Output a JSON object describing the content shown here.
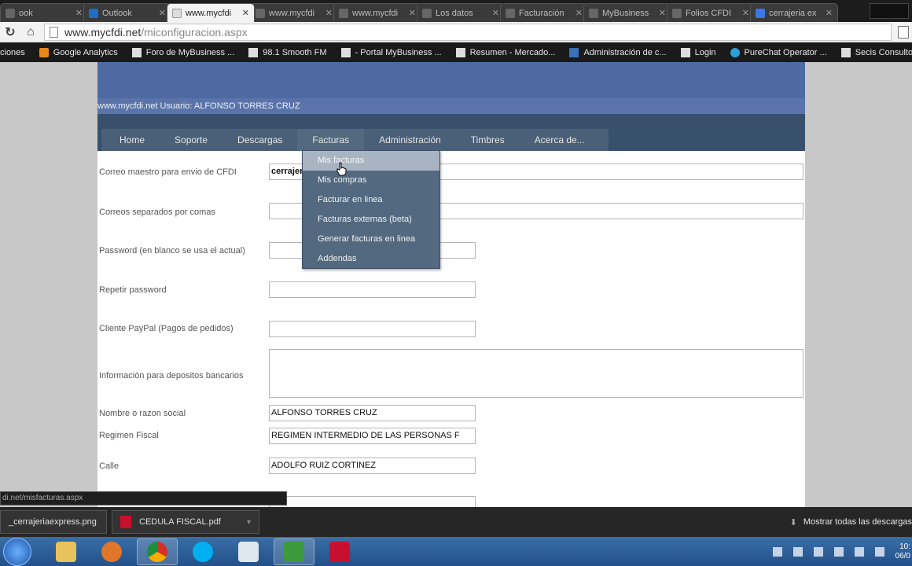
{
  "browser": {
    "tabs": [
      {
        "label": "ook",
        "active": false
      },
      {
        "label": "Outlook",
        "active": false
      },
      {
        "label": "www.mycfdi",
        "active": true
      },
      {
        "label": "www.mycfdi",
        "active": false
      },
      {
        "label": "www.mycfdi",
        "active": false
      },
      {
        "label": "Los datos",
        "active": false
      },
      {
        "label": "Facturación",
        "active": false
      },
      {
        "label": "MyBusiness",
        "active": false
      },
      {
        "label": "Folios CFDI",
        "active": false
      },
      {
        "label": "cerrajeria ex",
        "active": false
      }
    ],
    "url_domain": "www.mycfdi.net",
    "url_path": "/miconfiguracion.aspx",
    "bookmarks": [
      "ciones",
      "Google Analytics",
      "Foro de MyBusiness ...",
      "98.1 Smooth FM",
      "- Portal MyBusiness ...",
      "Resumen - Mercado...",
      "Administración de c...",
      "Login",
      "PureChat Operator ...",
      "Secis Consultores - ..."
    ]
  },
  "site": {
    "user_line": "www.mycfdi.net Usuario: ALFONSO TORRES CRUZ",
    "menu": [
      "Home",
      "Soporte",
      "Descargas",
      "Facturas",
      "Administración",
      "Timbres",
      "Acerca de..."
    ],
    "facturas_dropdown": [
      "Mis facturas",
      "Mis compras",
      "Facturar en linea",
      "Facturas externas (beta)",
      "Generar facturas en linea",
      "Addendas"
    ]
  },
  "form": {
    "correo_maestro_label": "Correo maestro para envio de CFDI",
    "correo_maestro_value": "cerrajeria",
    "correos_sep_label": "Correos separados por comas",
    "correos_sep_value": "",
    "password_label": "Password (en blanco se usa el actual)",
    "password_value": "",
    "repetir_label": "Repetir password",
    "repetir_value": "",
    "paypal_label": "Cliente PayPal (Pagos de pedidos)",
    "paypal_value": "",
    "depositos_label": "Información para depositos bancarios",
    "depositos_value": "",
    "nombre_label": "Nombre o razon social",
    "nombre_value": "ALFONSO TORRES CRUZ",
    "regimen_label": "Regimen Fiscal",
    "regimen_value": "REGIMEN INTERMEDIO DE LAS PERSONAS F",
    "calle_label": "Calle",
    "calle_value": "ADOLFO RUIZ CORTINEZ"
  },
  "status_link": "di.net/misfacturas.aspx",
  "downloads": {
    "items": [
      "_cerrajeriaexpress.png",
      "CEDULA FISCAL.pdf"
    ],
    "show_all": "Mostrar todas las descargas"
  },
  "clock": {
    "time": "10:",
    "date": "06/0"
  }
}
